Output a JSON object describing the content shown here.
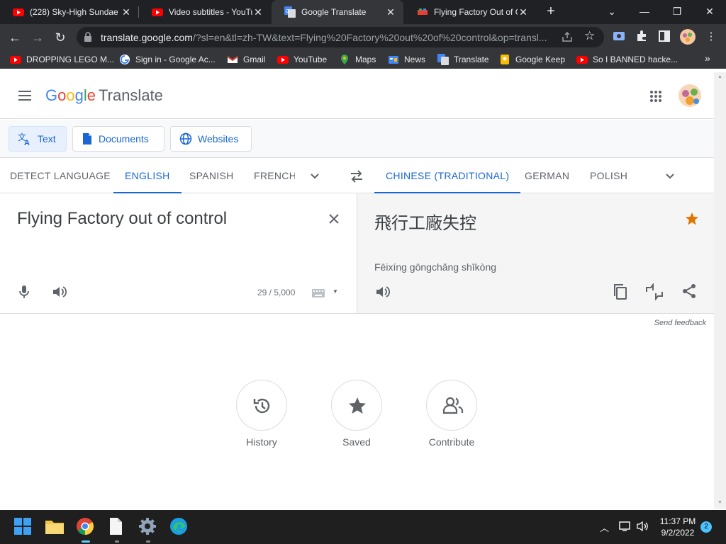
{
  "browser": {
    "tabs": [
      {
        "title": "(228) Sky-High Sundae",
        "favicon": "youtube-icon"
      },
      {
        "title": "Video subtitles - YouTu",
        "favicon": "youtube-icon"
      },
      {
        "title": "Google Translate",
        "favicon": "google-translate-icon"
      },
      {
        "title": "Flying Factory Out of C",
        "favicon": "lego-icon"
      }
    ],
    "url_host": "translate.google.com",
    "url_path": "/?sl=en&tl=zh-TW&text=Flying%20Factory%20out%20of%20control&op=transl...",
    "bookmarks": [
      {
        "label": "DROPPING LEGO M...",
        "icon": "youtube-icon"
      },
      {
        "label": "Sign in - Google Ac...",
        "icon": "google-icon"
      },
      {
        "label": "Gmail",
        "icon": "gmail-icon"
      },
      {
        "label": "YouTube",
        "icon": "youtube-icon"
      },
      {
        "label": "Maps",
        "icon": "maps-icon"
      },
      {
        "label": "News",
        "icon": "news-icon"
      },
      {
        "label": "Translate",
        "icon": "translate-icon"
      },
      {
        "label": "Google Keep",
        "icon": "keep-icon"
      },
      {
        "label": "So I BANNED hacke...",
        "icon": "youtube-icon"
      }
    ],
    "bookmarks_more": "»"
  },
  "app": {
    "logo_letters": [
      "G",
      "o",
      "o",
      "g",
      "l",
      "e"
    ],
    "product": "Translate"
  },
  "modes": {
    "text": "Text",
    "documents": "Documents",
    "websites": "Websites"
  },
  "source_langs": [
    "DETECT LANGUAGE",
    "ENGLISH",
    "SPANISH",
    "FRENCH"
  ],
  "target_langs": [
    "CHINESE (TRADITIONAL)",
    "GERMAN",
    "POLISH"
  ],
  "source": {
    "text": "Flying Factory out of control",
    "count": "29 / 5,000"
  },
  "target": {
    "text": "飛行工廠失控",
    "transliteration": "Fēixíng gōngchǎng shīkòng"
  },
  "feedback": "Send feedback",
  "bottom_actions": {
    "history": "History",
    "saved": "Saved",
    "contribute": "Contribute"
  },
  "taskbar": {
    "time": "11:37 PM",
    "date": "9/2/2022",
    "notifications": "2"
  },
  "colors": {
    "accent": "#1967d2",
    "star": "#e37400",
    "chrome_dark": "#202124",
    "chrome_toolbar": "#35363a"
  }
}
